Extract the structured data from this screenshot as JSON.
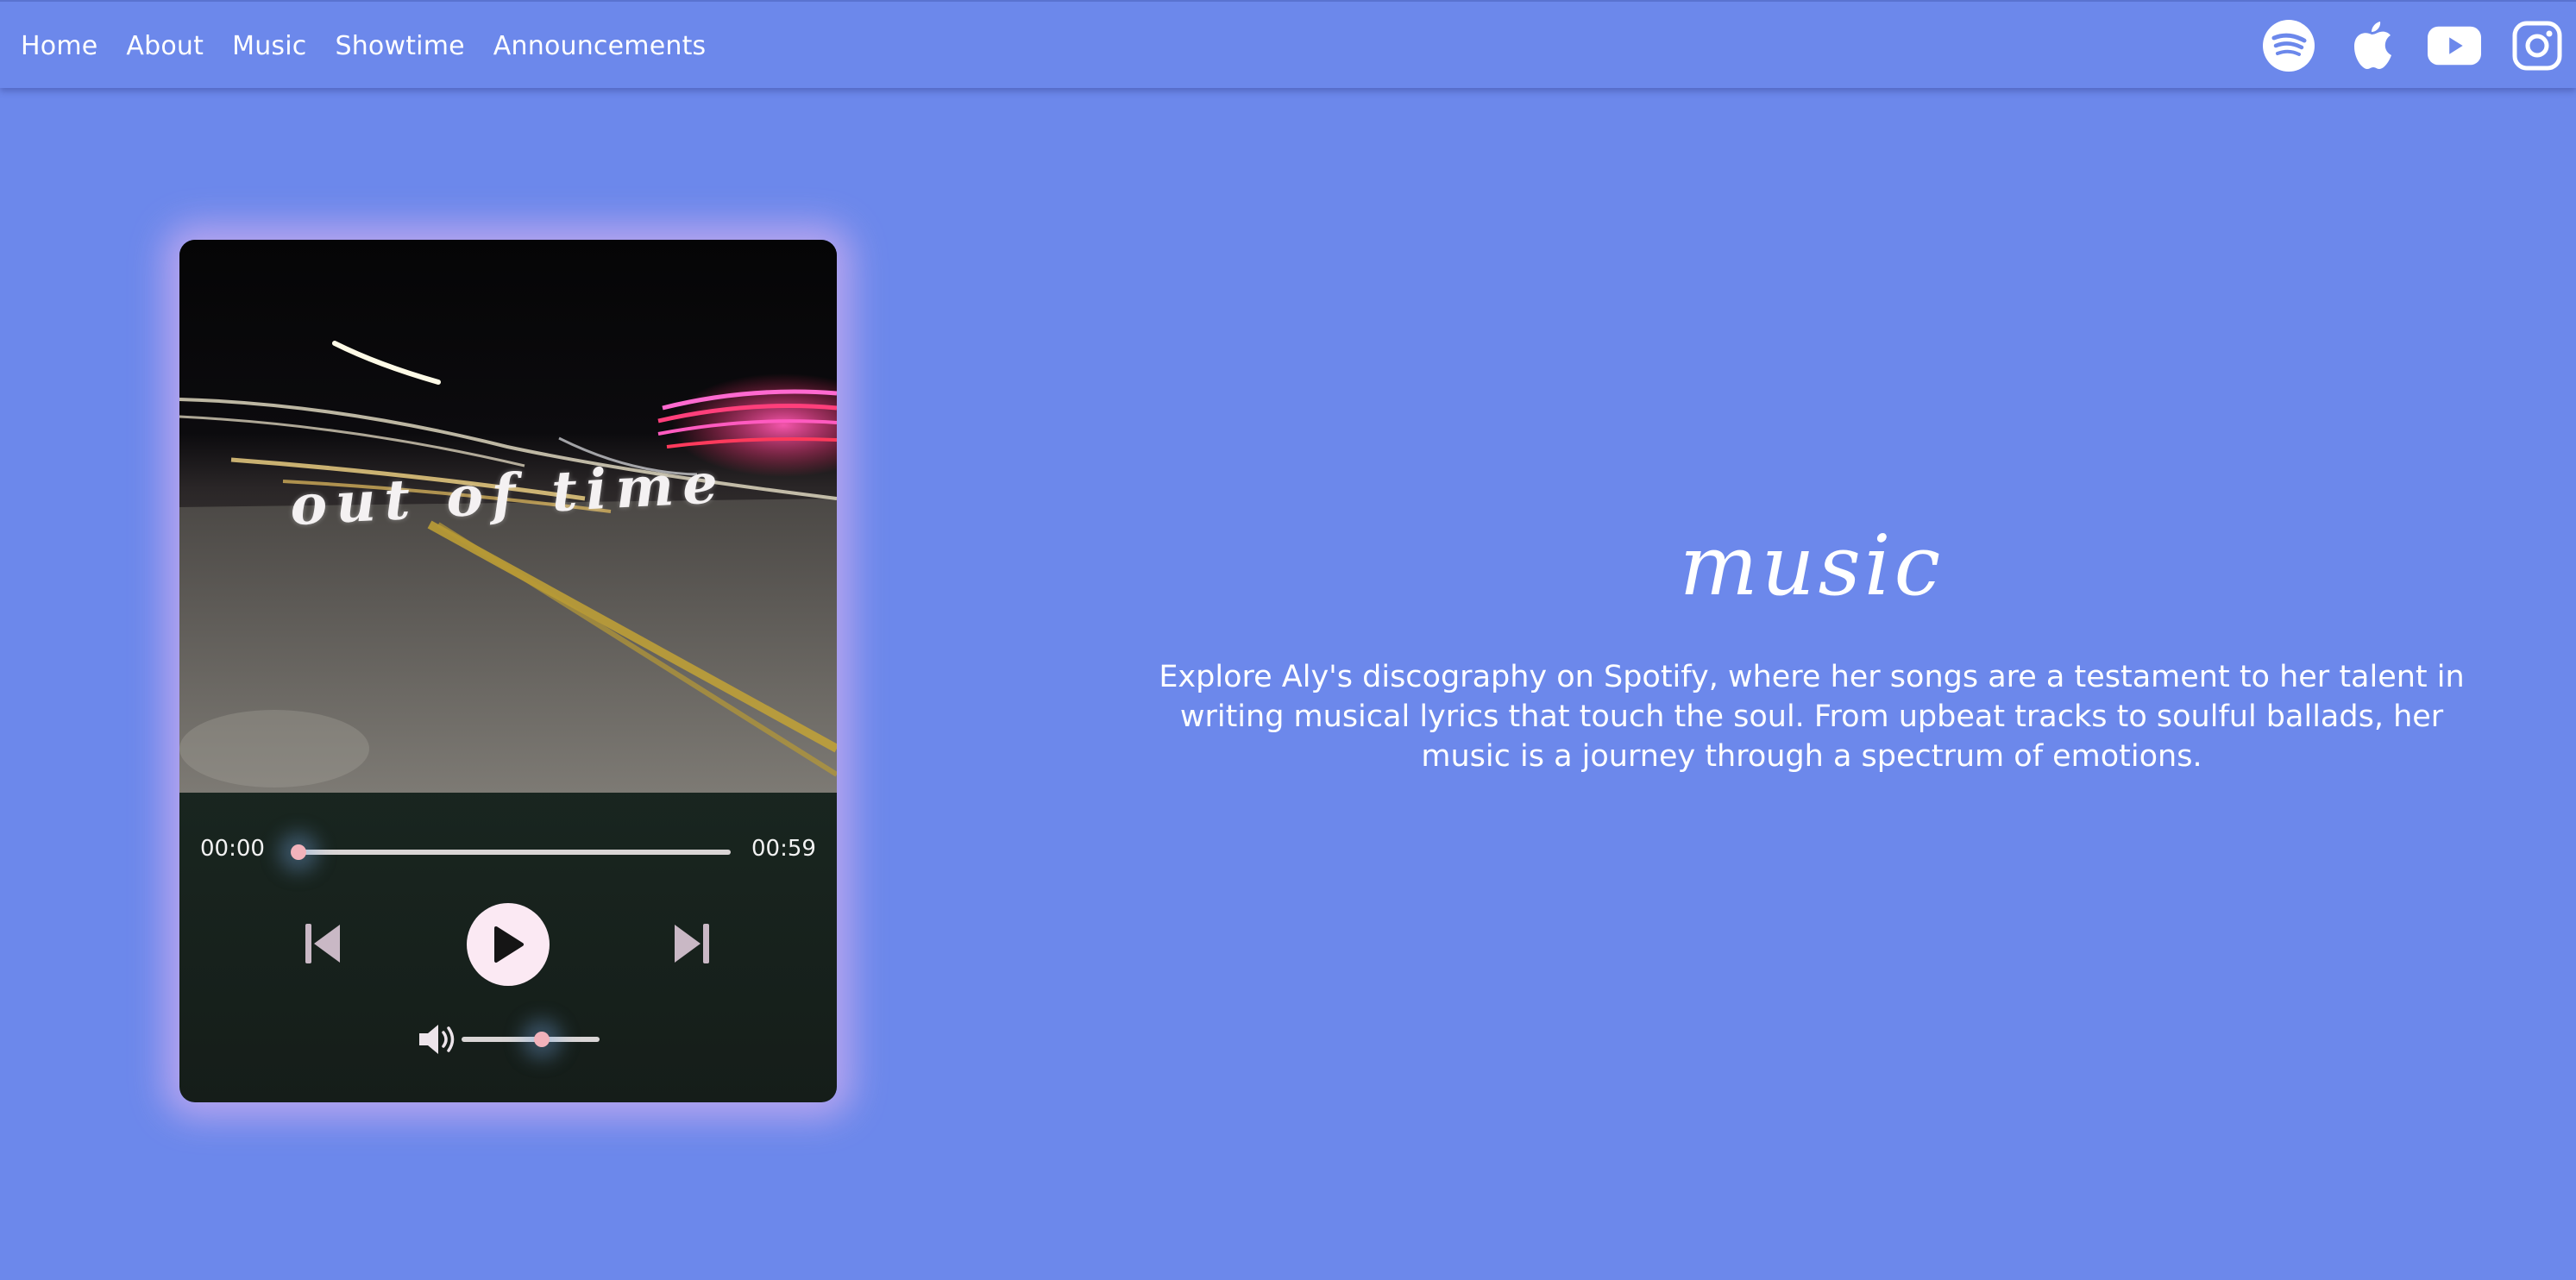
{
  "nav": {
    "links": [
      "Home",
      "About",
      "Music",
      "Showtime",
      "Announcements"
    ]
  },
  "social": {
    "icons": [
      "spotify-icon",
      "apple-icon",
      "youtube-icon",
      "instagram-icon"
    ]
  },
  "player": {
    "cover_title": "out of time",
    "current_time": "00:00",
    "total_time": "00:59",
    "progress": 0.0,
    "volume": 0.5
  },
  "main": {
    "heading": "music",
    "description": "Explore Aly's discography on Spotify, where her songs are a testament to her talent in writing musical lyrics that touch the soul. From upbeat tracks to soulful ballads, her music is a journey through a spectrum of emotions."
  },
  "colors": {
    "background": "#6c88eb",
    "accent_pink": "#f2b2bb",
    "play_button": "#fbe9f3",
    "card_glow": "#ceaef0"
  }
}
